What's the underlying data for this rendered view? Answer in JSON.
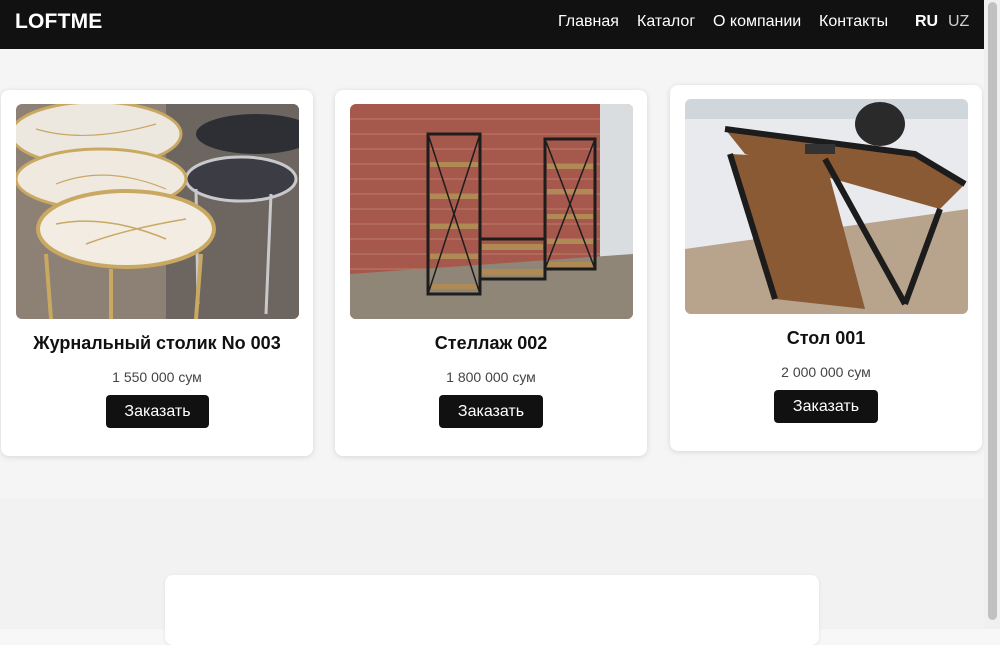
{
  "header": {
    "logo": "LOFTME",
    "nav": [
      "Главная",
      "Каталог",
      "О компании",
      "Контакты"
    ],
    "languages": {
      "active": "RU",
      "inactive": "UZ"
    }
  },
  "products": [
    {
      "name": "Журнальный столик No 003",
      "price": "1 550 000 сум",
      "button": "Заказать",
      "image": "marble-coffee-tables-photo"
    },
    {
      "name": "Стеллаж 002",
      "price": "1 800 000 сум",
      "button": "Заказать",
      "image": "loft-shelving-photo"
    },
    {
      "name": "Стол 001",
      "price": "2 000 000 сум",
      "button": "Заказать",
      "image": "office-desk-photo"
    }
  ],
  "colors": {
    "header_bg": "#111111",
    "button_bg": "#111111",
    "page_bg": "#f5f5f5"
  }
}
